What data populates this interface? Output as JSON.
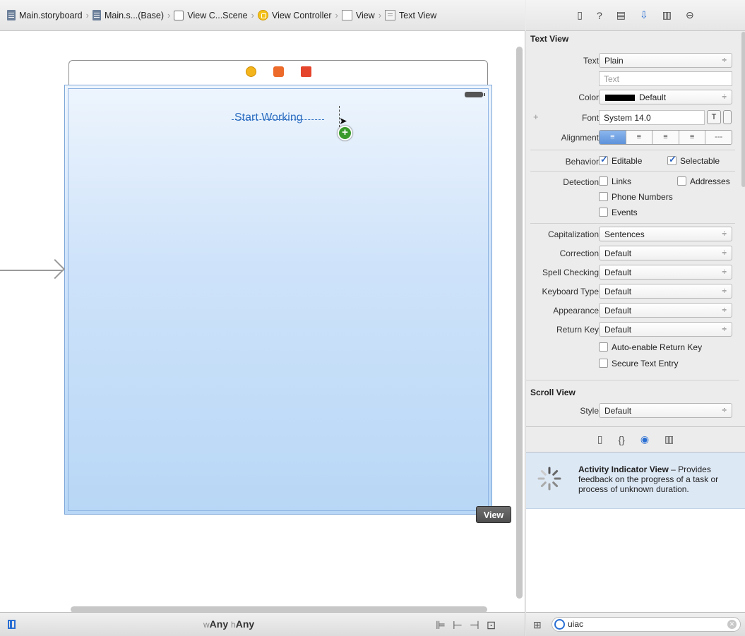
{
  "breadcrumb": [
    {
      "label": "Main.storyboard",
      "icon": "storyboard-file-icon"
    },
    {
      "label": "Main.s...(Base)",
      "icon": "storyboard-file-icon"
    },
    {
      "label": "View C...Scene",
      "icon": "scene-icon"
    },
    {
      "label": "View Controller",
      "icon": "view-controller-icon"
    },
    {
      "label": "View",
      "icon": "view-icon"
    },
    {
      "label": "Text View",
      "icon": "text-view-icon"
    }
  ],
  "canvas": {
    "text_view_label": "Start Working",
    "view_tag": "View",
    "size_class": {
      "w_prefix": "w",
      "w_value": "Any",
      "h_prefix": "h",
      "h_value": "Any"
    }
  },
  "inspector": {
    "tabs": [
      "file",
      "help",
      "identity",
      "attributes",
      "size",
      "connections"
    ],
    "active_tab": "attributes",
    "text_view": {
      "section_title": "Text View",
      "text_label": "Text",
      "text_value": "Plain",
      "text_placeholder": "Text",
      "color_label": "Color",
      "color_value": "Default",
      "font_label": "Font",
      "font_value": "System 14.0",
      "font_button": "T",
      "alignment_label": "Alignment",
      "alignment_options": [
        "left",
        "center",
        "right",
        "justified",
        "natural"
      ],
      "behavior_label": "Behavior",
      "editable": "Editable",
      "selectable": "Selectable",
      "detection_label": "Detection",
      "links": "Links",
      "addresses": "Addresses",
      "phone_numbers": "Phone Numbers",
      "events": "Events",
      "capitalization_label": "Capitalization",
      "capitalization_value": "Sentences",
      "correction_label": "Correction",
      "correction_value": "Default",
      "spell_label": "Spell Checking",
      "spell_value": "Default",
      "keyboard_label": "Keyboard Type",
      "keyboard_value": "Default",
      "appearance_label": "Appearance",
      "appearance_value": "Default",
      "return_label": "Return Key",
      "return_value": "Default",
      "auto_enable": "Auto-enable Return Key",
      "secure": "Secure Text Entry"
    },
    "scroll_view": {
      "section_title": "Scroll View",
      "style_label": "Style",
      "style_value": "Default"
    }
  },
  "library": {
    "tabs": [
      "file-template",
      "code-snippet",
      "object",
      "media"
    ],
    "active_tab": "object",
    "item_title": "Activity Indicator View",
    "item_desc": " – Provides feedback on the progress of a task or process of unknown duration.",
    "search_value": "uiac"
  },
  "colors": {
    "accent": "#2a6fd3",
    "scene_top": "#eef5fd",
    "scene_bottom": "#b8d7f6"
  }
}
